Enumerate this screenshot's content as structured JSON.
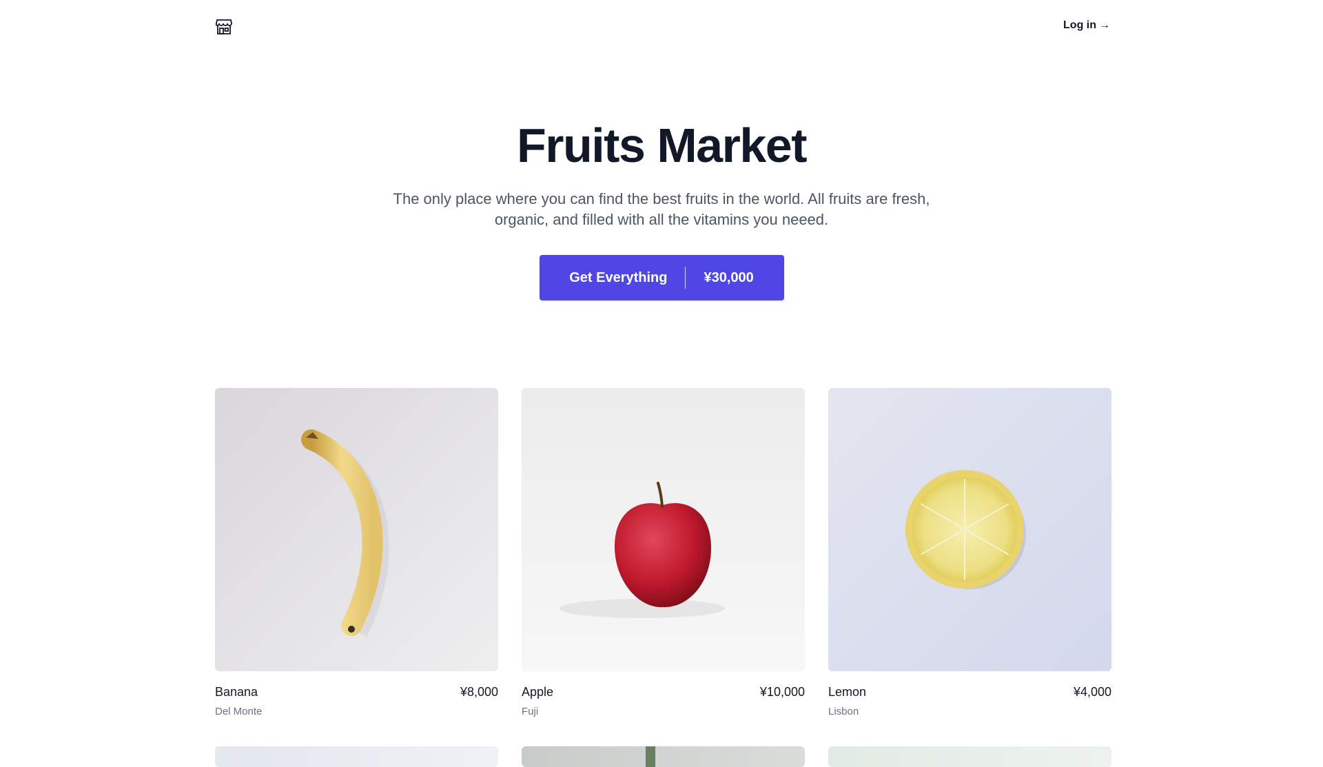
{
  "header": {
    "logo_icon": "storefront-icon",
    "login_label": "Log in",
    "login_arrow": "→"
  },
  "hero": {
    "title": "Fruits Market",
    "description": "The only place where you can find the best fruits in the world. All fruits are fresh, organic, and filled with all the vitamins you neeed.",
    "cta_label": "Get Everything",
    "cta_price": "¥30,000",
    "accent": "#4f46e5"
  },
  "products": [
    {
      "name": "Banana",
      "price": "¥8,000",
      "brand": "Del Monte"
    },
    {
      "name": "Apple",
      "price": "¥10,000",
      "brand": "Fuji"
    },
    {
      "name": "Lemon",
      "price": "¥4,000",
      "brand": "Lisbon"
    }
  ]
}
